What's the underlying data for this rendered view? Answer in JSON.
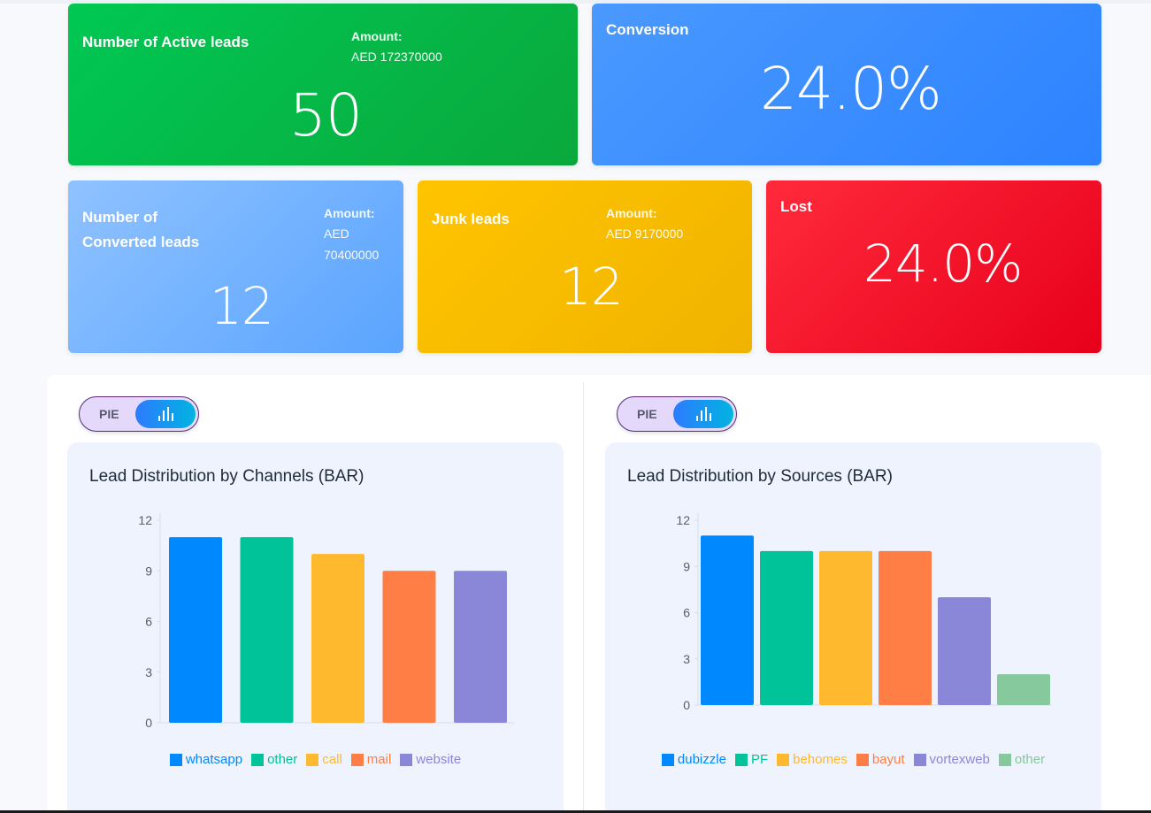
{
  "cards": {
    "active": {
      "title": "Number of Active leads",
      "amount_label": "Amount:",
      "amount": "AED 172370000",
      "value": "50"
    },
    "conversion": {
      "title": "Conversion",
      "value": "24.0%"
    },
    "converted": {
      "title_line1": "Number of",
      "title_line2": "Converted leads",
      "amount_label": "Amount:",
      "amount_line1": "AED",
      "amount_line2": "70400000",
      "value": "12"
    },
    "junk": {
      "title": "Junk leads",
      "amount_label": "Amount:",
      "amount": "AED 9170000",
      "value": "12"
    },
    "lost": {
      "title": "Lost",
      "value": "24.0%"
    }
  },
  "toggles": [
    {
      "label": "PIE",
      "active": "bar-chart-icon"
    },
    {
      "label": "PIE",
      "active": "bar-chart-icon"
    }
  ],
  "colors": {
    "active": "#00c853",
    "conversion": "#2d82ff",
    "converted": "#5aa4ff",
    "junk": "#f0b300",
    "lost": "#e8001a"
  },
  "chart_data": [
    {
      "type": "bar",
      "title": "Lead Distribution by Channels (BAR)",
      "categories": [
        "whatsapp",
        "other",
        "call",
        "mail",
        "website"
      ],
      "values": [
        11,
        11,
        10,
        9,
        9
      ],
      "colors": [
        "#0088ff",
        "#00c39a",
        "#ffb92e",
        "#ff7e45",
        "#8a87d8"
      ],
      "yticks": [
        0,
        3,
        6,
        9,
        12
      ],
      "ylim": [
        0,
        12
      ],
      "legend": "bottom",
      "grid": false
    },
    {
      "type": "bar",
      "title": "Lead Distribution by Sources (BAR)",
      "categories": [
        "dubizzle",
        "PF",
        "behomes",
        "bayut",
        "vortexweb",
        "other"
      ],
      "values": [
        11,
        10,
        10,
        10,
        7,
        2
      ],
      "colors": [
        "#0088ff",
        "#00c39a",
        "#ffb92e",
        "#ff7e45",
        "#8a87d8",
        "#85c99c"
      ],
      "yticks": [
        0,
        3,
        6,
        9,
        12
      ],
      "ylim": [
        0,
        12
      ],
      "legend": "bottom",
      "grid": false
    }
  ]
}
